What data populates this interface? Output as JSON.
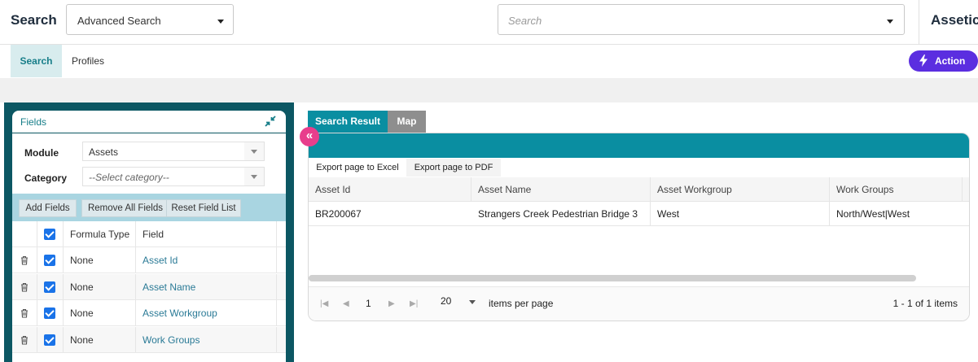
{
  "header": {
    "title": "Search",
    "search_mode": "Advanced Search",
    "search_placeholder": "Search",
    "brand": "Assetic"
  },
  "subnav": {
    "tabs": [
      {
        "label": "Search",
        "active": true
      },
      {
        "label": "Profiles",
        "active": false
      }
    ],
    "action_label": "Action"
  },
  "fields_panel": {
    "title": "Fields",
    "module_label": "Module",
    "module_value": "Assets",
    "category_label": "Category",
    "category_placeholder": "--Select category--",
    "buttons": [
      "Add Fields",
      "Remove All Fields",
      "Reset Field List"
    ],
    "columns": [
      "Formula Type",
      "Field"
    ],
    "rows": [
      {
        "formula_type": "None",
        "field": "Asset Id",
        "checked": true
      },
      {
        "formula_type": "None",
        "field": "Asset Name",
        "checked": true
      },
      {
        "formula_type": "None",
        "field": "Asset Workgroup",
        "checked": true
      },
      {
        "formula_type": "None",
        "field": "Work Groups",
        "checked": true
      }
    ]
  },
  "results": {
    "tabs": [
      "Search Result",
      "Map"
    ],
    "export_excel": "Export page to Excel",
    "export_pdf": "Export page to PDF",
    "columns": [
      "Asset Id",
      "Asset Name",
      "Asset Workgroup",
      "Work Groups"
    ],
    "rows": [
      [
        "BR200067",
        "Strangers Creek Pedestrian Bridge 3",
        "West",
        "North/West|West"
      ]
    ],
    "pager": {
      "page": "1",
      "page_size": "20",
      "items_per_page_label": "items per page",
      "summary": "1 - 1 of 1 items"
    }
  },
  "colors": {
    "teal": "#0a8ea1",
    "dark_teal": "#0c5763",
    "action_purple": "#5b2ee0",
    "toggle_pink": "#e83e8c"
  }
}
